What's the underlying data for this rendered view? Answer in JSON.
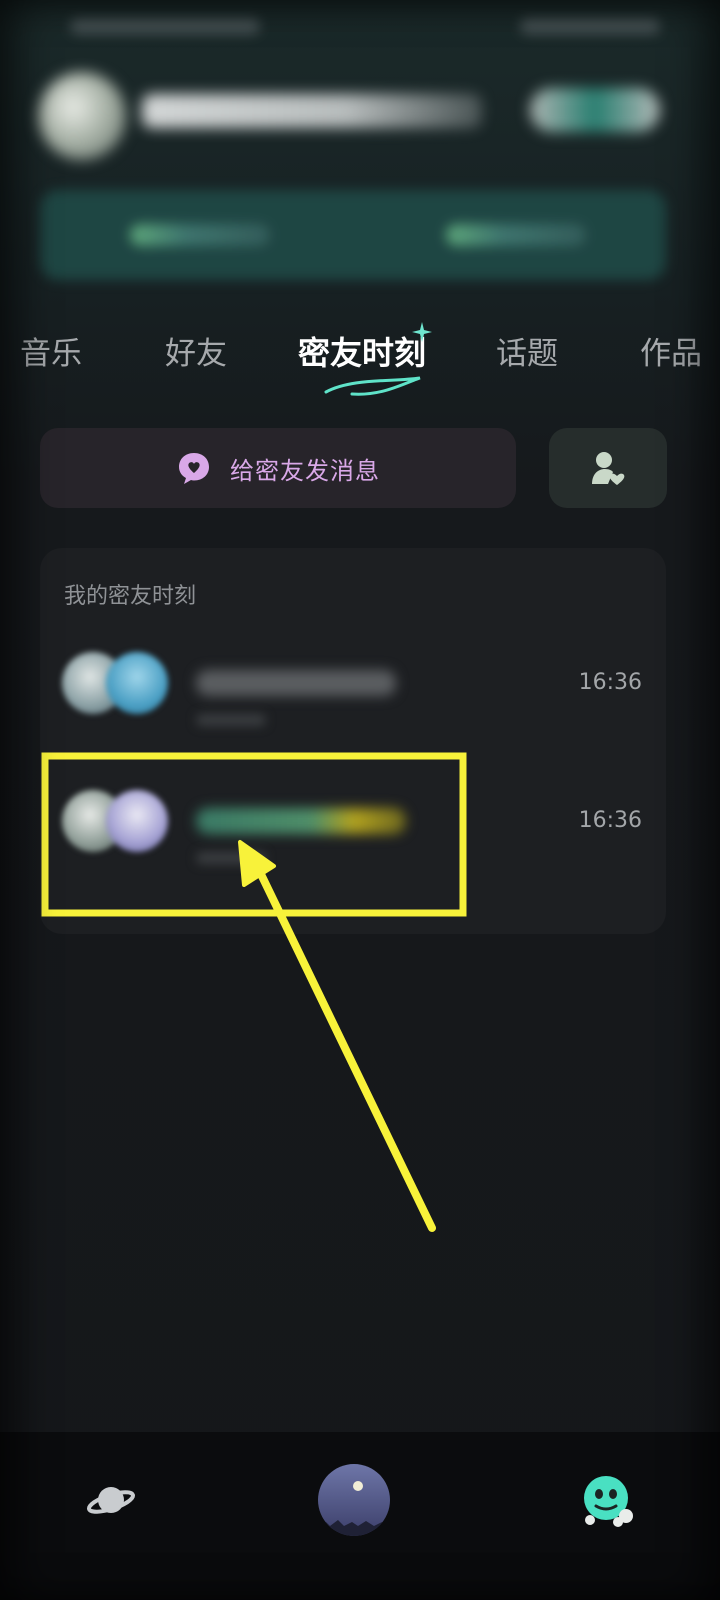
{
  "tabs": [
    {
      "label": "音乐",
      "active": false
    },
    {
      "label": "好友",
      "active": false
    },
    {
      "label": "密友时刻",
      "active": true
    },
    {
      "label": "话题",
      "active": false
    },
    {
      "label": "作品",
      "active": false
    }
  ],
  "message_button": {
    "label": "给密友发消息",
    "icon": "heart-chat-icon"
  },
  "friend_button": {
    "icon": "friend-heart-icon"
  },
  "moments": {
    "title": "我的密友时刻",
    "rows": [
      {
        "time": "16:36"
      },
      {
        "time": "16:36"
      }
    ]
  },
  "bottom_nav": {
    "items": [
      {
        "icon": "planet-icon"
      },
      {
        "icon": "center-avatar"
      },
      {
        "icon": "mascot-icon"
      }
    ]
  },
  "colors": {
    "accent_purple": "#d9a8e8",
    "annotation_yellow": "#f8f23a",
    "tab_active": "#ffffff",
    "tab_inactive": "#a6a9ac"
  }
}
